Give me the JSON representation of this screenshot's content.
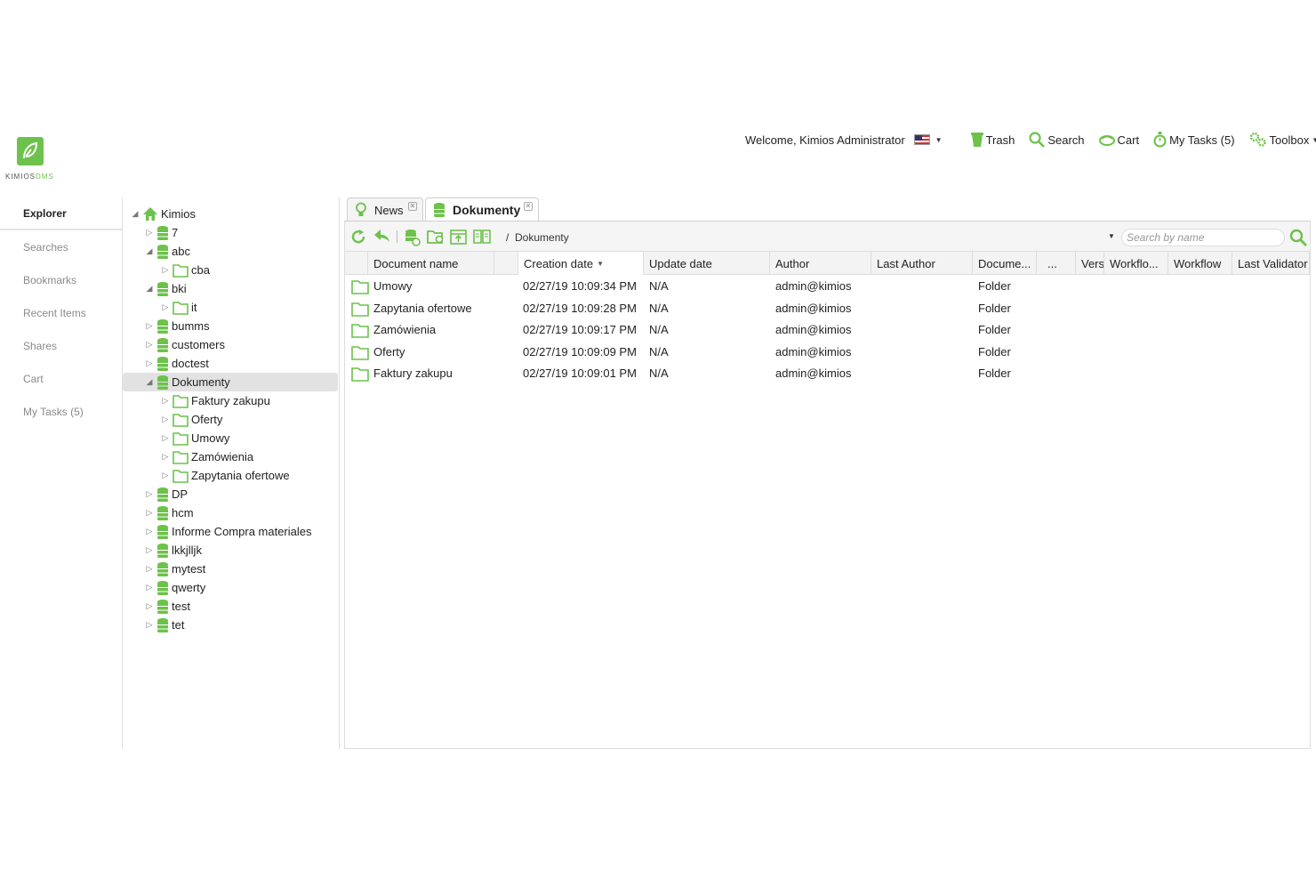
{
  "logo": {
    "text_main": "KIMIOS",
    "text_accent": "DMS"
  },
  "topbar": {
    "welcome": "Welcome, Kimios Administrator",
    "trash": "Trash",
    "search": "Search",
    "cart": "Cart",
    "my_tasks": "My Tasks (5)",
    "toolbox": "Toolbox"
  },
  "leftnav": {
    "items": [
      "Explorer",
      "Searches",
      "Bookmarks",
      "Recent Items",
      "Shares",
      "Cart",
      "My Tasks (5)"
    ]
  },
  "tree": {
    "rows": [
      {
        "label": "Kimios",
        "toggle": "◢",
        "icon": "home-icon",
        "depth": 0
      },
      {
        "label": "7",
        "toggle": "▷",
        "icon": "workspace-icon",
        "depth": 1
      },
      {
        "label": "abc",
        "toggle": "◢",
        "icon": "workspace-icon",
        "depth": 1
      },
      {
        "label": "cba",
        "toggle": "▷",
        "icon": "folder-icon",
        "depth": 2
      },
      {
        "label": "bki",
        "toggle": "◢",
        "icon": "workspace-icon",
        "depth": 1
      },
      {
        "label": "it",
        "toggle": "▷",
        "icon": "folder-icon",
        "depth": 2
      },
      {
        "label": "bumms",
        "toggle": "▷",
        "icon": "workspace-icon",
        "depth": 1
      },
      {
        "label": "customers",
        "toggle": "▷",
        "icon": "workspace-icon",
        "depth": 1
      },
      {
        "label": "doctest",
        "toggle": "▷",
        "icon": "workspace-icon",
        "depth": 1
      },
      {
        "label": "Dokumenty",
        "toggle": "◢",
        "icon": "workspace-icon",
        "depth": 1
      },
      {
        "label": "Faktury zakupu",
        "toggle": "▷",
        "icon": "folder-icon",
        "depth": 2
      },
      {
        "label": "Oferty",
        "toggle": "▷",
        "icon": "folder-icon",
        "depth": 2
      },
      {
        "label": "Umowy",
        "toggle": "▷",
        "icon": "folder-icon",
        "depth": 2
      },
      {
        "label": "Zamówienia",
        "toggle": "▷",
        "icon": "folder-icon",
        "depth": 2
      },
      {
        "label": "Zapytania ofertowe",
        "toggle": "▷",
        "icon": "folder-icon",
        "depth": 2
      },
      {
        "label": "DP",
        "toggle": "▷",
        "icon": "workspace-icon",
        "depth": 1
      },
      {
        "label": "hcm",
        "toggle": "▷",
        "icon": "workspace-icon",
        "depth": 1
      },
      {
        "label": "Informe Compra materiales",
        "toggle": "▷",
        "icon": "workspace-icon",
        "depth": 1
      },
      {
        "label": "lkkjlljk",
        "toggle": "▷",
        "icon": "workspace-icon",
        "depth": 1
      },
      {
        "label": "mytest",
        "toggle": "▷",
        "icon": "workspace-icon",
        "depth": 1
      },
      {
        "label": "qwerty",
        "toggle": "▷",
        "icon": "workspace-icon",
        "depth": 1
      },
      {
        "label": "test",
        "toggle": "▷",
        "icon": "workspace-icon",
        "depth": 1
      },
      {
        "label": "tet",
        "toggle": "▷",
        "icon": "workspace-icon",
        "depth": 1
      }
    ],
    "selected": "Dokumenty"
  },
  "tabs": [
    {
      "label": "News",
      "icon": "bulb-icon",
      "active": false
    },
    {
      "label": "Dokumenty",
      "icon": "workspace-icon",
      "active": true
    }
  ],
  "toolbar": {
    "path_sep": "/",
    "path": "Dokumenty",
    "search_placeholder": "Search by name"
  },
  "grid": {
    "columns": [
      "Document name",
      "",
      "Creation date",
      "Update date",
      "Author",
      "Last Author",
      "Docume...",
      "...",
      "Vers",
      "Workflo...",
      "Workflow",
      "Last Validator"
    ],
    "sorted_column": "Creation date",
    "rows": [
      {
        "name": "Umowy",
        "created": "02/27/19 10:09:34 PM",
        "updated": "N/A",
        "author": "admin@kimios",
        "type": "Folder"
      },
      {
        "name": "Zapytania ofertowe",
        "created": "02/27/19 10:09:28 PM",
        "updated": "N/A",
        "author": "admin@kimios",
        "type": "Folder"
      },
      {
        "name": "Zamówienia",
        "created": "02/27/19 10:09:17 PM",
        "updated": "N/A",
        "author": "admin@kimios",
        "type": "Folder"
      },
      {
        "name": "Oferty",
        "created": "02/27/19 10:09:09 PM",
        "updated": "N/A",
        "author": "admin@kimios",
        "type": "Folder"
      },
      {
        "name": "Faktury zakupu",
        "created": "02/27/19 10:09:01 PM",
        "updated": "N/A",
        "author": "admin@kimios",
        "type": "Folder"
      }
    ]
  },
  "colors": {
    "accent": "#6cc24a",
    "selected_bg": "#e2e2e2"
  }
}
